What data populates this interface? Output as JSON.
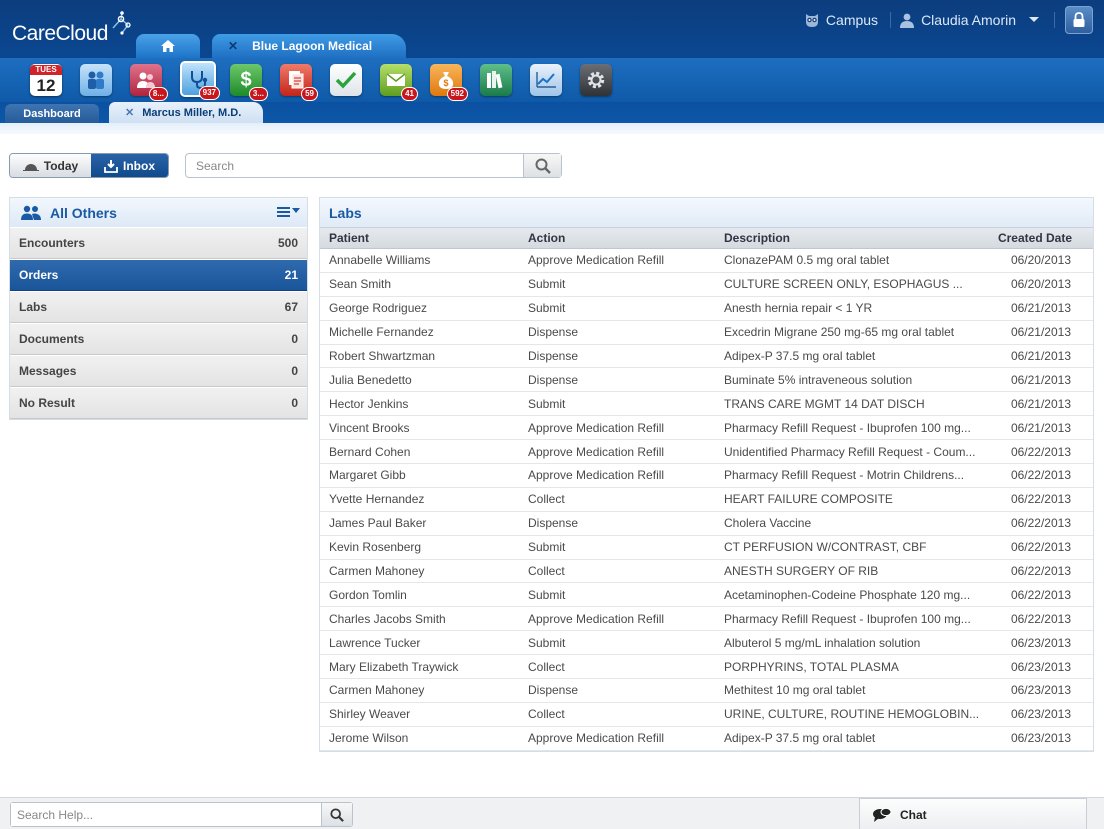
{
  "app": {
    "logo": "CareCloud",
    "campus_label": "Campus",
    "user_name": "Claudia Amorin",
    "context_tab": "Blue Lagoon Medical",
    "close_glyph": "✕"
  },
  "toolbar": {
    "calendar_day": "TUES",
    "calendar_date": "12",
    "icons": [
      {
        "name": "calendar-icon",
        "badge": ""
      },
      {
        "name": "patients-icon",
        "badge": ""
      },
      {
        "name": "users-group-icon",
        "badge": "8..."
      },
      {
        "name": "stethoscope-icon",
        "badge": "937"
      },
      {
        "name": "billing-dollar-icon",
        "badge": "3..."
      },
      {
        "name": "documents-icon",
        "badge": "59"
      },
      {
        "name": "tasks-check-icon",
        "badge": ""
      },
      {
        "name": "messages-icon",
        "badge": "41"
      },
      {
        "name": "money-bag-icon",
        "badge": "592"
      },
      {
        "name": "library-icon",
        "badge": ""
      },
      {
        "name": "reports-chart-icon",
        "badge": ""
      },
      {
        "name": "settings-gear-icon",
        "badge": ""
      }
    ]
  },
  "page_tabs": {
    "dashboard": "Dashboard",
    "doctor": "Marcus Miller, M.D."
  },
  "controls": {
    "today_label": "Today",
    "inbox_label": "Inbox",
    "search_placeholder": "Search"
  },
  "left_panel": {
    "title": "All Others",
    "categories": [
      {
        "label": "Encounters",
        "count": "500"
      },
      {
        "label": "Orders",
        "count": "21"
      },
      {
        "label": "Labs",
        "count": "67"
      },
      {
        "label": "Documents",
        "count": "0"
      },
      {
        "label": "Messages",
        "count": "0"
      },
      {
        "label": "No Result",
        "count": "0"
      }
    ]
  },
  "table": {
    "title": "Labs",
    "columns": [
      "Patient",
      "Action",
      "Description",
      "Created Date"
    ],
    "rows": [
      [
        "Annabelle Williams",
        "Approve Medication Refill",
        "ClonazePAM 0.5 mg oral tablet",
        "06/20/2013"
      ],
      [
        "Sean Smith",
        "Submit",
        "CULTURE SCREEN ONLY, ESOPHAGUS ...",
        "06/20/2013"
      ],
      [
        "George Rodriguez",
        "Submit",
        "Anesth hernia repair < 1 YR",
        "06/21/2013"
      ],
      [
        "Michelle Fernandez",
        "Dispense",
        "Excedrin Migrane 250 mg-65 mg oral tablet",
        "06/21/2013"
      ],
      [
        "Robert Shwartzman",
        "Dispense",
        "Adipex-P 37.5 mg oral tablet",
        "06/21/2013"
      ],
      [
        "Julia Benedetto",
        "Dispense",
        "Buminate 5% intraveneous solution",
        "06/21/2013"
      ],
      [
        "Hector Jenkins",
        "Submit",
        "TRANS CARE MGMT 14 DAT DISCH",
        "06/21/2013"
      ],
      [
        "Vincent Brooks",
        "Approve Medication Refill",
        "Pharmacy Refill Request - Ibuprofen 100 mg...",
        "06/21/2013"
      ],
      [
        "Bernard Cohen",
        "Approve Medication Refill",
        "Unidentified Pharmacy Refill Request - Coum...",
        "06/22/2013"
      ],
      [
        "Margaret Gibb",
        "Approve Medication Refill",
        "Pharmacy Refill Request - Motrin Childrens...",
        "06/22/2013"
      ],
      [
        "Yvette Hernandez",
        "Collect",
        "HEART FAILURE COMPOSITE",
        "06/22/2013"
      ],
      [
        "James Paul Baker",
        "Dispense",
        "Cholera Vaccine",
        "06/22/2013"
      ],
      [
        "Kevin Rosenberg",
        "Submit",
        "CT PERFUSION W/CONTRAST, CBF",
        "06/22/2013"
      ],
      [
        "Carmen Mahoney",
        "Collect",
        "ANESTH SURGERY OF RIB",
        "06/22/2013"
      ],
      [
        "Gordon Tomlin",
        "Submit",
        "Acetaminophen-Codeine Phosphate 120 mg...",
        "06/22/2013"
      ],
      [
        "Charles Jacobs Smith",
        "Approve Medication Refill",
        "Pharmacy Refill Request - Ibuprofen 100 mg...",
        "06/22/2013"
      ],
      [
        "Lawrence Tucker",
        "Submit",
        "Albuterol 5 mg/mL inhalation solution",
        "06/23/2013"
      ],
      [
        "Mary Elizabeth Traywick",
        "Collect",
        "PORPHYRINS, TOTAL PLASMA",
        "06/23/2013"
      ],
      [
        "Carmen Mahoney",
        "Dispense",
        "Methitest 10 mg oral tablet",
        "06/23/2013"
      ],
      [
        "Shirley Weaver",
        "Collect",
        "URINE, CULTURE, ROUTINE HEMOGLOBIN...",
        "06/23/2013"
      ],
      [
        "Jerome Wilson",
        "Approve Medication Refill",
        "Adipex-P 37.5 mg oral tablet",
        "06/23/2013"
      ]
    ]
  },
  "footer": {
    "help_placeholder": "Search Help...",
    "chat_label": "Chat"
  },
  "colors": {
    "header_blue": "#0a4a96",
    "active_row": "#1a559a",
    "badge_red": "#c8171c",
    "title_blue": "#1a5aa3"
  }
}
